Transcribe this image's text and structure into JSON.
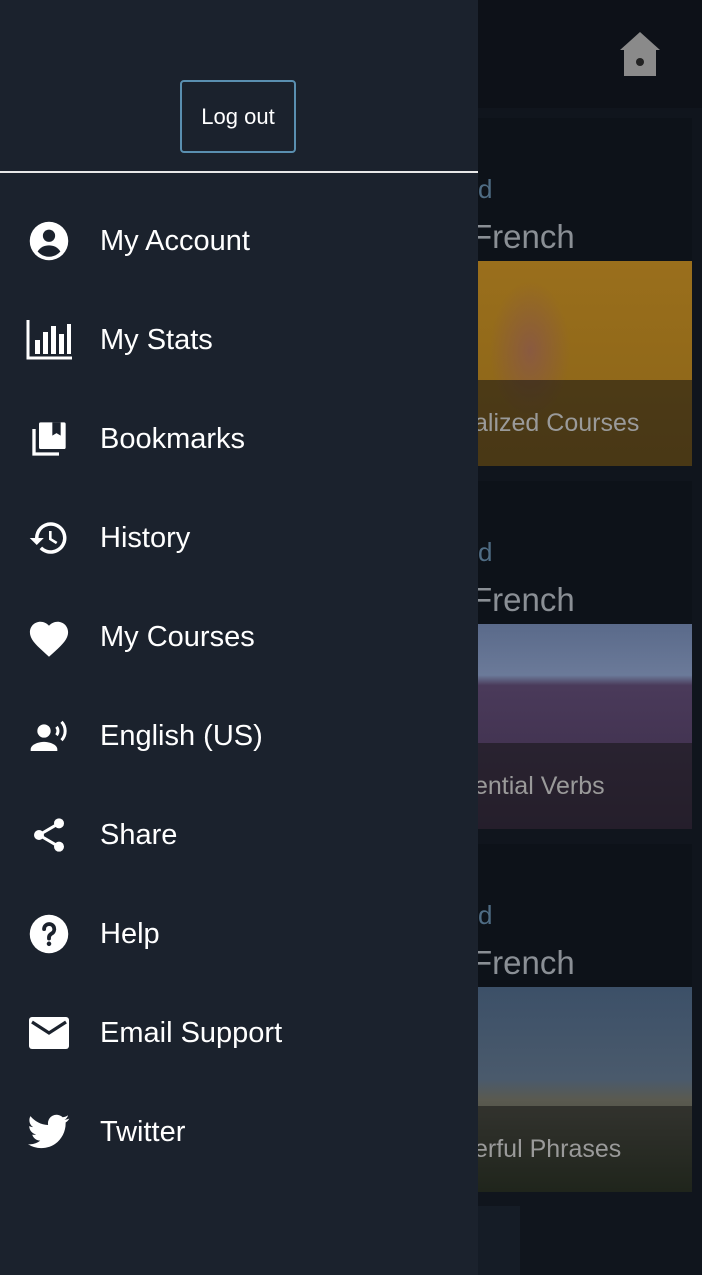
{
  "drawer": {
    "logout_label": "Log out",
    "items": [
      {
        "label": "My Account",
        "icon": "account-circle-icon"
      },
      {
        "label": "My Stats",
        "icon": "bar-chart-icon"
      },
      {
        "label": "Bookmarks",
        "icon": "bookmarks-icon"
      },
      {
        "label": "History",
        "icon": "history-icon"
      },
      {
        "label": "My Courses",
        "icon": "heart-icon"
      },
      {
        "label": "English (US)",
        "icon": "voice-person-icon"
      },
      {
        "label": "Share",
        "icon": "share-icon"
      },
      {
        "label": "Help",
        "icon": "help-icon"
      },
      {
        "label": "Email Support",
        "icon": "email-icon"
      },
      {
        "label": "Twitter",
        "icon": "twitter-icon"
      }
    ]
  },
  "background": {
    "home_icon": "home-icon",
    "cards": [
      {
        "kicker": "d",
        "title": "French",
        "caption": "alized Courses"
      },
      {
        "kicker": "d",
        "title": "French",
        "caption": "ential Verbs"
      },
      {
        "kicker": "d",
        "title": "French",
        "caption": "erful Phrases"
      }
    ]
  },
  "colors": {
    "drawer_bg": "#1b222d",
    "logout_border": "#5a8fb0",
    "overlay_bg": "#10151d"
  }
}
